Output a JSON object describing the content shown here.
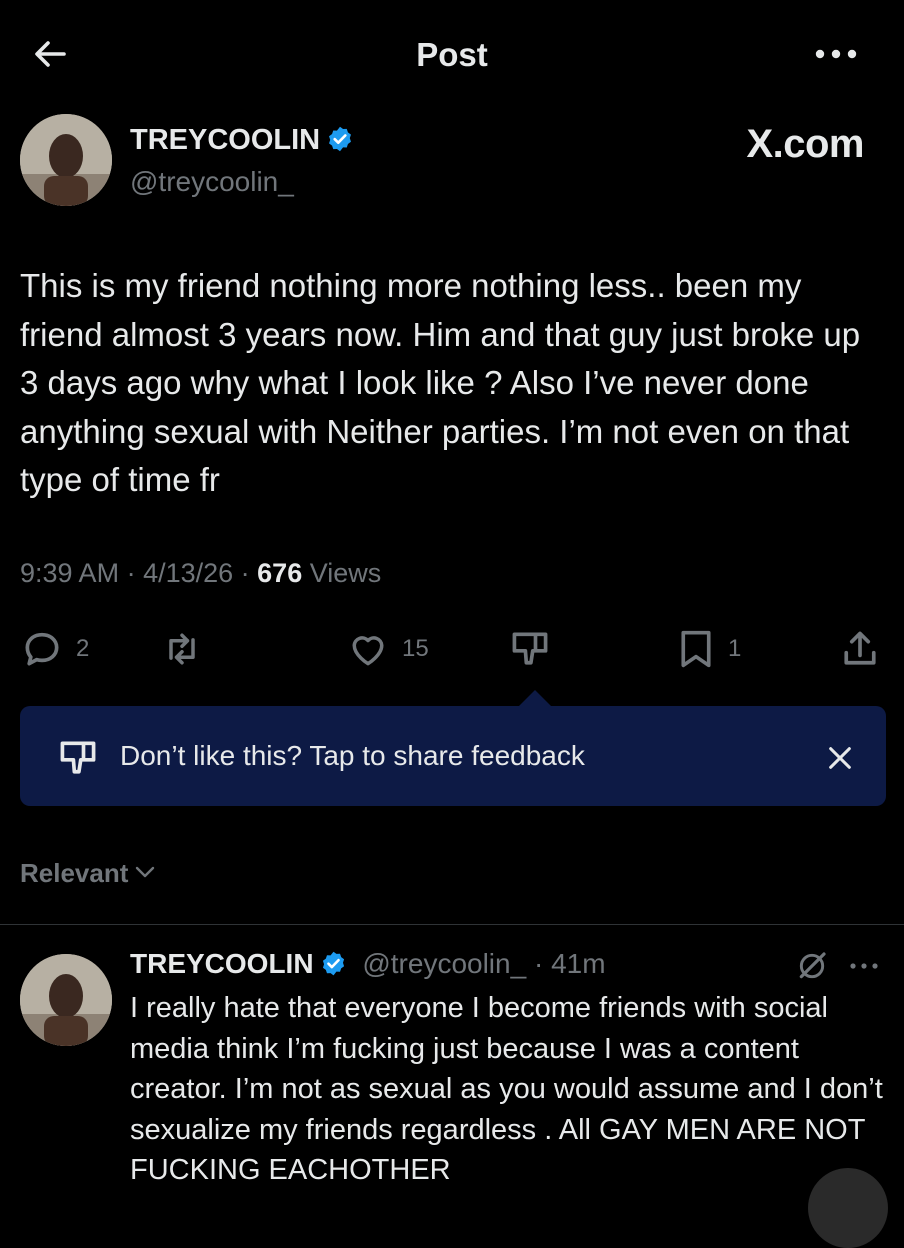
{
  "header": {
    "title": "Post",
    "back_icon": "arrow-left-icon",
    "more_icon": "more-horizontal-icon"
  },
  "author": {
    "name": "TREYCOOLIN",
    "handle": "@treycoolin_",
    "verified": true,
    "site_badge": "X.com"
  },
  "post": {
    "text": "This is my friend nothing more nothing less.. been my friend almost 3 years now. Him and that guy just broke up 3 days ago why what I look like ? Also I’ve never done anything sexual with Neither parties. I’m not even on that type of time fr",
    "time": "9:39 AM",
    "date": "4/13/26",
    "views_count": "676",
    "views_label": "Views"
  },
  "actions": {
    "replies": "2",
    "reposts": "",
    "likes": "15",
    "bookmarks": "1"
  },
  "feedback_banner": {
    "text": "Don’t like this? Tap to share feedback"
  },
  "sort": {
    "label": "Relevant"
  },
  "reply": {
    "name": "TREYCOOLIN",
    "handle": "@treycoolin_",
    "time": "41m",
    "text": "I really hate that everyone I become friends with social media think I’m fucking just because I was a content creator. I’m not as sexual as you would assume and I don’t sexualize my friends regardless . All GAY MEN ARE NOT FUCKING EACHOTHER"
  },
  "colors": {
    "background": "#000000",
    "text": "#e7e9ea",
    "muted": "#71767b",
    "verified": "#1d9bf0",
    "banner": "#0d1a45"
  }
}
